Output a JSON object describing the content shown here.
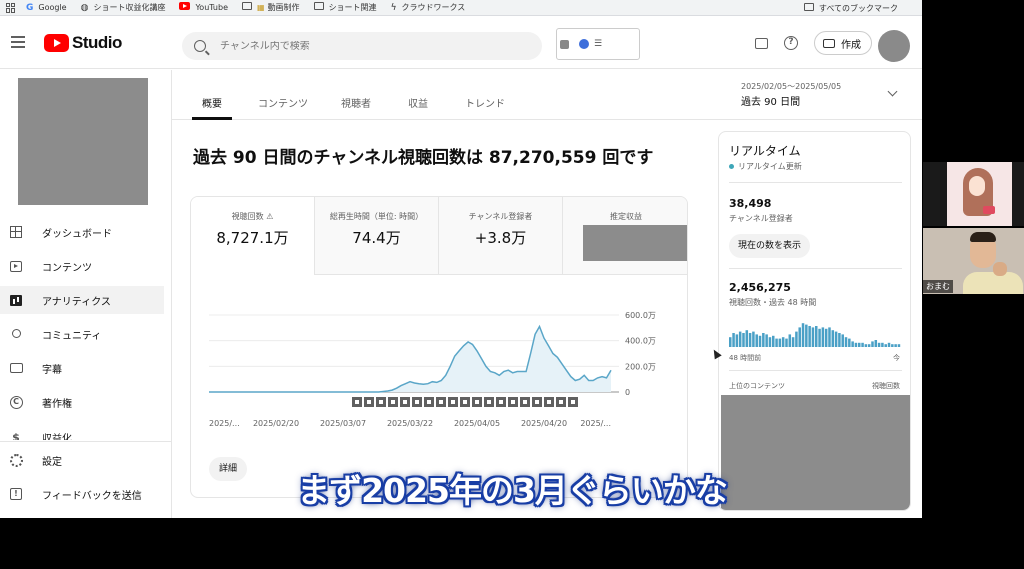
{
  "bookmarks": [
    {
      "label": "Google",
      "icon": "google-icon"
    },
    {
      "label": "ショート収益化講座",
      "icon": "globe-icon"
    },
    {
      "label": "YouTube",
      "icon": "youtube-icon"
    },
    {
      "label": "動画制作",
      "icon": "folder-icon"
    },
    {
      "label": "ショート関連",
      "icon": "folder-icon"
    },
    {
      "label": "クラウドワークス",
      "icon": "crowdworks-icon"
    }
  ],
  "bookmarks_all": "すべてのブックマーク",
  "header": {
    "logo_text": "Studio",
    "search_placeholder": "チャンネル内で検索",
    "create_label": "作成"
  },
  "sidebar": {
    "items": [
      {
        "label": "ダッシュボード",
        "icon": "dashboard-icon"
      },
      {
        "label": "コンテンツ",
        "icon": "content-icon"
      },
      {
        "label": "アナリティクス",
        "icon": "analytics-icon",
        "active": true
      },
      {
        "label": "コミュニティ",
        "icon": "community-icon"
      },
      {
        "label": "字幕",
        "icon": "subtitles-icon"
      },
      {
        "label": "著作権",
        "icon": "copyright-icon"
      },
      {
        "label": "収益化",
        "icon": "monetization-icon"
      }
    ],
    "bottom": [
      {
        "label": "設定",
        "icon": "settings-icon"
      },
      {
        "label": "フィードバックを送信",
        "icon": "feedback-icon"
      }
    ]
  },
  "tabs": [
    "概要",
    "コンテンツ",
    "視聴者",
    "収益",
    "トレンド"
  ],
  "date": {
    "range": "2025/02/05～2025/05/05",
    "label": "過去 90 日間"
  },
  "headline": "過去 90 日間のチャンネル視聴回数は 87,270,559 回です",
  "metrics": [
    {
      "label": "視聴回数",
      "value": "8,727.1万",
      "warn": "⚠"
    },
    {
      "label": "総再生時間（単位: 時間）",
      "value": "74.4万"
    },
    {
      "label": "チャンネル登録者",
      "value": "+3.8万"
    },
    {
      "label": "推定収益",
      "value": ""
    }
  ],
  "detail_button": "詳細",
  "chart_data": {
    "type": "line",
    "x_tick_labels": [
      "2025/...",
      "2025/02/20",
      "2025/03/07",
      "2025/03/22",
      "2025/04/05",
      "2025/04/20",
      "2025/..."
    ],
    "y_tick_labels": [
      "600.0万",
      "400.0万",
      "200.0万",
      "0"
    ],
    "ylim": [
      0,
      6000000
    ],
    "values": [
      3000,
      3000,
      3000,
      3000,
      3000,
      3000,
      3000,
      3000,
      3000,
      3000,
      3000,
      3000,
      3000,
      3000,
      3000,
      3000,
      3000,
      3000,
      3000,
      3000,
      3000,
      3000,
      3000,
      3000,
      3000,
      3000,
      3000,
      3000,
      3000,
      3000,
      3000,
      3000,
      3000,
      3000,
      3000,
      3000,
      3000,
      3000,
      3000,
      40000,
      80000,
      150000,
      300000,
      500000,
      650000,
      800000,
      700000,
      650000,
      600000,
      650000,
      800000,
      750000,
      900000,
      1300000,
      2000000,
      2800000,
      3200000,
      3600000,
      3900000,
      3700000,
      3200000,
      2600000,
      2000000,
      1600000,
      1500000,
      1300000,
      1600000,
      1700000,
      1500000,
      1600000,
      1600000,
      1600000,
      3000000,
      4500000,
      5100000,
      4200000,
      3600000,
      3000000,
      2700000,
      2200000,
      1700000,
      1200000,
      900000,
      1000000,
      1300000,
      900000,
      900000,
      1100000,
      1200000,
      1100000,
      1700000
    ]
  },
  "realtime": {
    "title": "リアルタイム",
    "subtitle": "リアルタイム更新",
    "subscribers_value": "38,498",
    "subscribers_label": "チャンネル登録者",
    "show_count_button": "現在の数を表示",
    "views_value": "2,456,275",
    "views_label": "視聴回数・過去 48 時間",
    "bars": [
      0.35,
      0.5,
      0.45,
      0.55,
      0.5,
      0.6,
      0.5,
      0.55,
      0.45,
      0.4,
      0.5,
      0.45,
      0.35,
      0.4,
      0.3,
      0.3,
      0.35,
      0.3,
      0.45,
      0.35,
      0.55,
      0.7,
      0.85,
      0.8,
      0.75,
      0.7,
      0.75,
      0.65,
      0.7,
      0.65,
      0.7,
      0.6,
      0.55,
      0.5,
      0.45,
      0.35,
      0.3,
      0.2,
      0.15,
      0.15,
      0.15,
      0.1,
      0.1,
      0.2,
      0.25,
      0.15,
      0.15,
      0.1,
      0.15,
      0.1,
      0.1,
      0.1
    ],
    "axis_left": "48 時間前",
    "axis_right": "今",
    "top_content_label": "上位のコンテンツ",
    "top_content_metric": "視聴回数"
  },
  "webcam": {
    "name_tag": "おまむ"
  },
  "subtitle": "まず2025年の3月ぐらいかな"
}
